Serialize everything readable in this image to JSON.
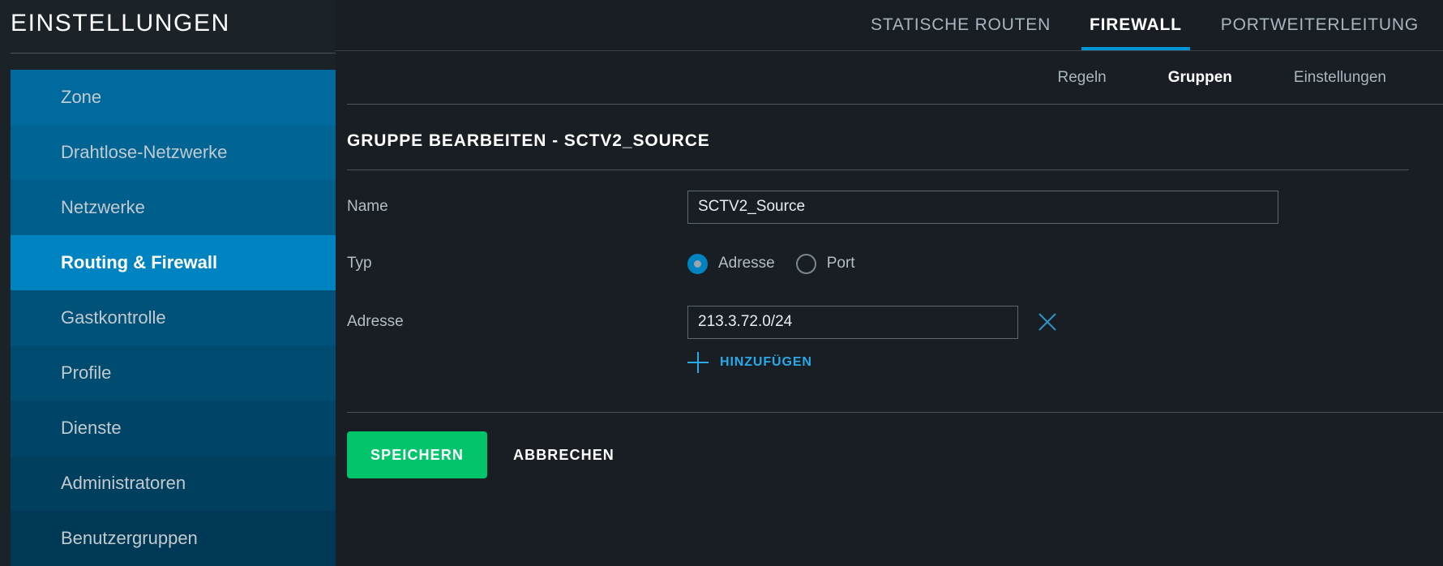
{
  "sidebar": {
    "title": "EINSTELLUNGEN",
    "items": [
      {
        "label": "Zone",
        "active": false
      },
      {
        "label": "Drahtlose-Netzwerke",
        "active": false
      },
      {
        "label": "Netzwerke",
        "active": false
      },
      {
        "label": "Routing & Firewall",
        "active": true
      },
      {
        "label": "Gastkontrolle",
        "active": false
      },
      {
        "label": "Profile",
        "active": false
      },
      {
        "label": "Dienste",
        "active": false
      },
      {
        "label": "Administratoren",
        "active": false
      },
      {
        "label": "Benutzergruppen",
        "active": false
      }
    ]
  },
  "topnav": {
    "tabs": [
      {
        "label": "STATISCHE ROUTEN",
        "active": false
      },
      {
        "label": "FIREWALL",
        "active": true
      },
      {
        "label": "PORTWEITERLEITUNG",
        "active": false
      }
    ]
  },
  "subnav": {
    "tabs": [
      {
        "label": "Regeln",
        "active": false
      },
      {
        "label": "Gruppen",
        "active": true
      },
      {
        "label": "Einstellungen",
        "active": false
      }
    ]
  },
  "panel": {
    "title": "GRUPPE BEARBEITEN - SCTV2_SOURCE",
    "fields": {
      "name": {
        "label": "Name",
        "value": "SCTV2_Source",
        "placeholder": ""
      },
      "typ": {
        "label": "Typ",
        "options": [
          {
            "label": "Adresse",
            "checked": true
          },
          {
            "label": "Port",
            "checked": false
          }
        ]
      },
      "adresse": {
        "label": "Adresse",
        "value": "213.3.72.0/24",
        "placeholder": "",
        "remove_icon": "close-x-icon",
        "add_icon": "plus-icon",
        "add_label": "HINZUFÜGEN"
      }
    },
    "actions": {
      "save_label": "SPEICHERN",
      "cancel_label": "ABBRECHEN"
    }
  },
  "colors": {
    "background": "#181E24",
    "sidebar_active": "#0083C1",
    "accent_blue": "#0096D6",
    "link_blue": "#28A9E8",
    "save_green": "#02C46A"
  }
}
